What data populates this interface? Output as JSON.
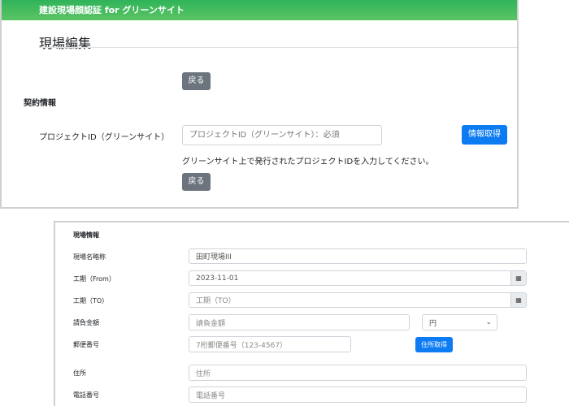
{
  "app_title": "建設現場顔認証 for グリーンサイト",
  "page_title": "現場編集",
  "back_label": "戻る",
  "contract": {
    "heading": "契約情報",
    "project_id_label": "プロジェクトID（グリーンサイト）",
    "project_id_placeholder": "プロジェクトID（グリーンサイト）：必須",
    "fetch_label": "情報取得",
    "help": "グリーンサイト上で発行されたプロジェクトIDを入力してください。"
  },
  "site": {
    "heading": "現場情報",
    "name_label": "現場名略称",
    "name_value": "田町現場III",
    "from_label": "工期（From）",
    "from_value": "2023-11-01",
    "to_label": "工期（TO）",
    "to_placeholder": "工期（TO）",
    "amount_label": "請負金額",
    "amount_placeholder": "請負金額",
    "currency": "円",
    "zip_label": "郵便番号",
    "zip_placeholder": "7桁郵便番号（123-4567）",
    "zip_button": "住所取得",
    "address_label": "住所",
    "address_placeholder": "住所",
    "phone_label": "電話番号",
    "phone_placeholder": "電話番号"
  }
}
